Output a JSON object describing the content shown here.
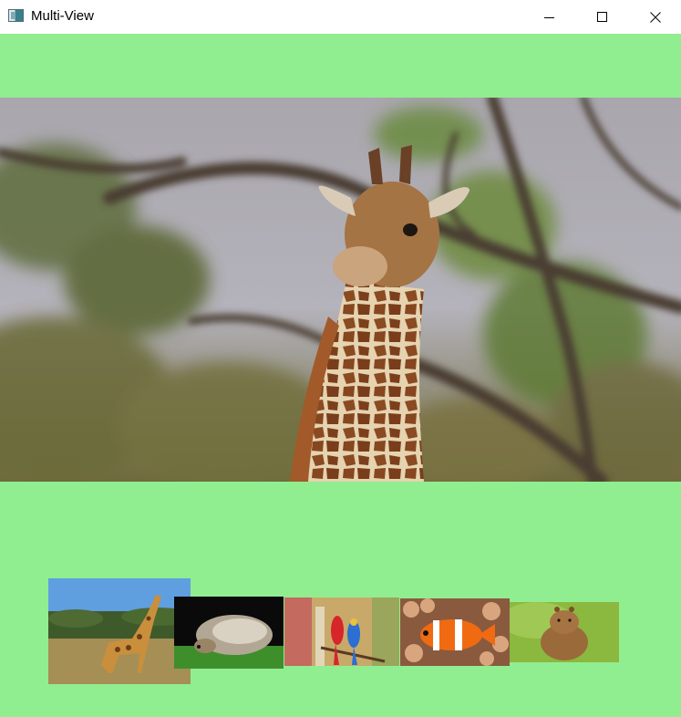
{
  "window": {
    "title": "Multi-View",
    "controls": {
      "minimize_icon": "minimize-icon",
      "maximize_icon": "maximize-icon",
      "close_icon": "close-icon"
    }
  },
  "colors": {
    "client_background": "#90ee90",
    "titlebar_background": "#ffffff"
  },
  "main_view": {
    "image": "giraffe-closeup-photo"
  },
  "thumbnails": [
    {
      "image": "giraffe-savanna-photo"
    },
    {
      "image": "hedgehog-photo"
    },
    {
      "image": "macaws-photo"
    },
    {
      "image": "clownfish-photo"
    },
    {
      "image": "capybara-photo"
    }
  ]
}
